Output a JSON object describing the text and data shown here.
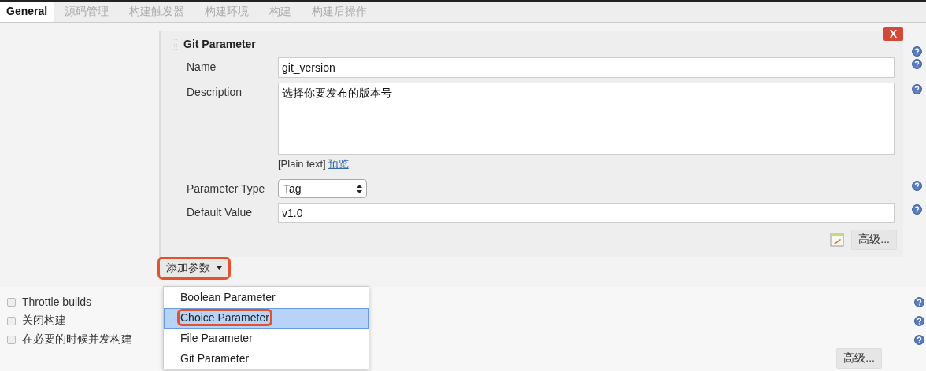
{
  "tabs": [
    {
      "label": "General",
      "selected": true
    },
    {
      "label": "源码管理",
      "selected": false
    },
    {
      "label": "构建触发器",
      "selected": false
    },
    {
      "label": "构建环境",
      "selected": false
    },
    {
      "label": "构建",
      "selected": false
    },
    {
      "label": "构建后操作",
      "selected": false
    }
  ],
  "parameter": {
    "title": "Git Parameter",
    "delete_button": "X",
    "fields": [
      {
        "kind": "text",
        "label": "Name",
        "value": "git_version"
      },
      {
        "kind": "textarea",
        "label": "Description",
        "value": "选择你要发布的版本号",
        "note": "[Plain text]",
        "link": "预览"
      },
      {
        "kind": "select",
        "label": "Parameter Type",
        "value": "Tag"
      },
      {
        "kind": "text",
        "label": "Default Value",
        "value": "v1.0"
      }
    ],
    "advanced_button": "高级..."
  },
  "add_button": {
    "label": "添加参数",
    "annotated": true
  },
  "menu": {
    "items": [
      {
        "label": "Boolean Parameter",
        "selected": false,
        "annotated": false
      },
      {
        "label": "Choice Parameter",
        "selected": true,
        "annotated": true
      },
      {
        "label": "File Parameter",
        "selected": false,
        "annotated": false
      },
      {
        "label": "Git Parameter",
        "selected": false,
        "annotated": false
      }
    ]
  },
  "options": [
    {
      "label": "Throttle builds",
      "checked": false
    },
    {
      "label": "关闭构建",
      "checked": false
    },
    {
      "label": "在必要的时候并发构建",
      "checked": false
    }
  ],
  "advanced_button": "高级..."
}
